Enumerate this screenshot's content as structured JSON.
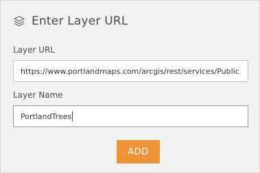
{
  "header": {
    "icon": "layers-icon",
    "title": "Enter Layer URL"
  },
  "form": {
    "url_label": "Layer URL",
    "url_value": "https://www.portlandmaps.com/arcgis/rest/services/Public",
    "name_label": "Layer Name",
    "name_value": "PortlandTrees"
  },
  "actions": {
    "add_label": "ADD"
  },
  "colors": {
    "panel_bg": "#f2f2f2",
    "accent": "#ee9238",
    "field_border": "#b9c3cc"
  }
}
